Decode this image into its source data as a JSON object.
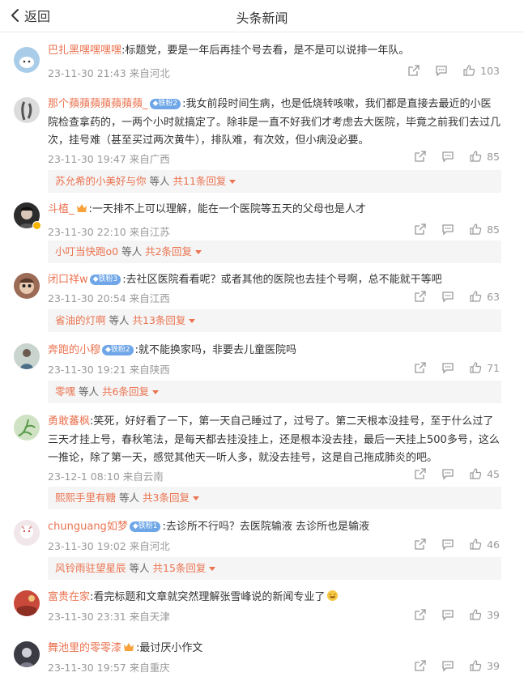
{
  "header": {
    "back_label": "返回",
    "title": "头条新闻"
  },
  "colors": {
    "accent": "#eb7350",
    "meta": "#999999",
    "reply_bg": "#f5f5f5",
    "level_badge": "#6ea6e8"
  },
  "comments": [
    {
      "user": "巴扎黑嘿嘿嘿嘿",
      "level": "",
      "body": ":标题党，要是一年后再挂个号去看，是不是可以说排一年队。",
      "time": "23-11-30 21:43",
      "loc": "来自河北",
      "likes": "103",
      "reply": null
    },
    {
      "user": "那个蘋蘋蘋蘋蘋蘋蘋_",
      "level": "铁粉2",
      "body": ":我女前段时间生病，也是低烧转咳嗽，我们都是直接去最近的小医院检查拿药的，一两个小时就搞定了。除非是一直不好我们才考虑去大医院，毕竟之前我们去过几次，挂号难（甚至买过两次黄牛），排队难，有次效，但小病没必要。",
      "time": "23-11-30 19:47",
      "loc": "来自广西",
      "likes": "85",
      "reply": {
        "name": "苏允希的小美好与你",
        "mid": "等人",
        "total": "共11条回复"
      }
    },
    {
      "user": "斗植_",
      "level": "",
      "crown": true,
      "body": ":一天排不上可以理解，能在一个医院等五天的父母也是人才",
      "time": "23-11-30 22:10",
      "loc": "来自江苏",
      "likes": "85",
      "reply": {
        "name": "小叮当快跑o0",
        "mid": "等人",
        "total": "共2条回复"
      }
    },
    {
      "user": "闭口祥w",
      "level": "铁粉3",
      "body": ":去社区医院看看呢？或者其他的医院也去挂个号啊，总不能就干等吧",
      "time": "23-11-30 20:54",
      "loc": "来自江西",
      "likes": "63",
      "reply": {
        "name": "省油的灯啊",
        "mid": "等人",
        "total": "共13条回复"
      }
    },
    {
      "user": "奔跑的小穆",
      "level": "铁粉2",
      "body": ":就不能换家吗，非要去儿童医院吗",
      "time": "23-11-30 19:21",
      "loc": "来自陕西",
      "likes": "71",
      "reply": {
        "name": "零嘿",
        "mid": "等人",
        "total": "共6条回复"
      }
    },
    {
      "user": "勇敢蕃枫",
      "level": "",
      "body": ":笑死，好好看了一下，第一天自己睡过了，过号了。第二天根本没挂号，至于什么过了三天才挂上号，春秋笔法，是每天都去挂没挂上，还是根本没去挂，最后一天挂上500多号，这么一推论，除了第一天，感觉其他天一听人多，就没去挂号，这是自己拖成肺炎的吧。",
      "time": "23-12-1 08:10",
      "loc": "来自云南",
      "likes": "45",
      "reply": {
        "name": "熙熙手里有糖",
        "mid": "等人",
        "total": "共3条回复"
      }
    },
    {
      "user": "chunguang如梦",
      "level": "铁粉1",
      "body": ":去诊所不行吗？去医院输液  去诊所也是输液",
      "time": "23-11-30 19:02",
      "loc": "来自河北",
      "likes": "46",
      "reply": {
        "name": "风铃雨驻望星辰",
        "mid": "等人",
        "total": "共15条回复"
      }
    },
    {
      "user": "富贵在家",
      "level": "",
      "body": ":看完标题和文章就突然理解张雪峰说的新闻专业了",
      "emoji": true,
      "time": "23-11-30 23:31",
      "loc": "来自天津",
      "likes": "39",
      "reply": null
    },
    {
      "user": "舞池里的零零漆",
      "level": "",
      "crown": true,
      "body": ":最讨厌小作文",
      "time": "23-11-30 19:57",
      "loc": "来自重庆",
      "likes": "39",
      "reply": null
    }
  ]
}
